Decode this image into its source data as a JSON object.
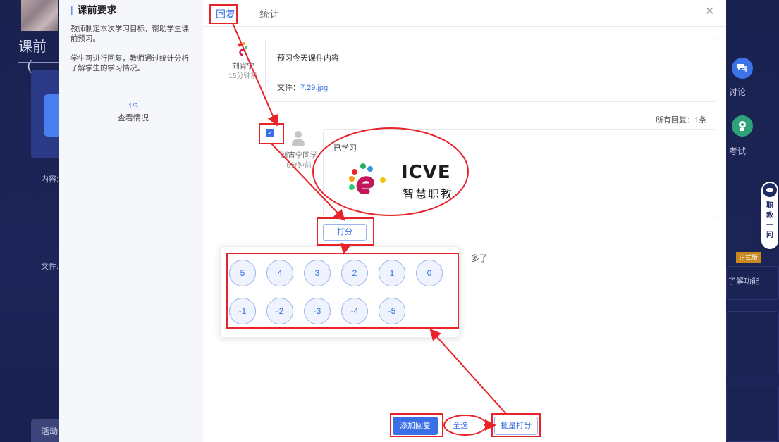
{
  "left_bg": {
    "title": "课前（",
    "content_label": "内容:",
    "file_label": "文件:",
    "activity_label": "活动"
  },
  "requirements": {
    "title": "课前要求",
    "text1": "教师制定本次学习目标，帮助学生课前预习。",
    "text2": "学生可进行回复，教师通过统计分析了解学生的学习情况。",
    "progress": "1/5",
    "view_label": "查看情况"
  },
  "tabs": {
    "reply": "回复",
    "stats": "统计"
  },
  "teacher_post": {
    "name": "刘宵宁",
    "time": "15分钟前",
    "content": "预习今天课件内容",
    "file_label": "文件：",
    "file_name": "7.29.jpg"
  },
  "all_replies": "所有回复：1条",
  "student_reply": {
    "name": "刘宵宁同学",
    "time": "6分钟前",
    "content": "已学习",
    "logo_text": "ICVE",
    "logo_cn": "智慧职教"
  },
  "score_button": "打分",
  "more_text": "多了",
  "scores_row1": [
    "5",
    "4",
    "3",
    "2",
    "1",
    "0"
  ],
  "scores_row2": [
    "-1",
    "-2",
    "-3",
    "-4",
    "-5"
  ],
  "bottom": {
    "add_reply": "添加回复",
    "select_all": "全选",
    "batch_score": "批量打分"
  },
  "right_bg": {
    "discuss": "讨论",
    "exam": "考试",
    "robot_text": "职教一问",
    "badge": "正式版",
    "feature": "了解功能"
  },
  "colors": {
    "accent": "#3a6fe6",
    "annotation": "#e8232a",
    "dark_bg": "#1b2355"
  }
}
